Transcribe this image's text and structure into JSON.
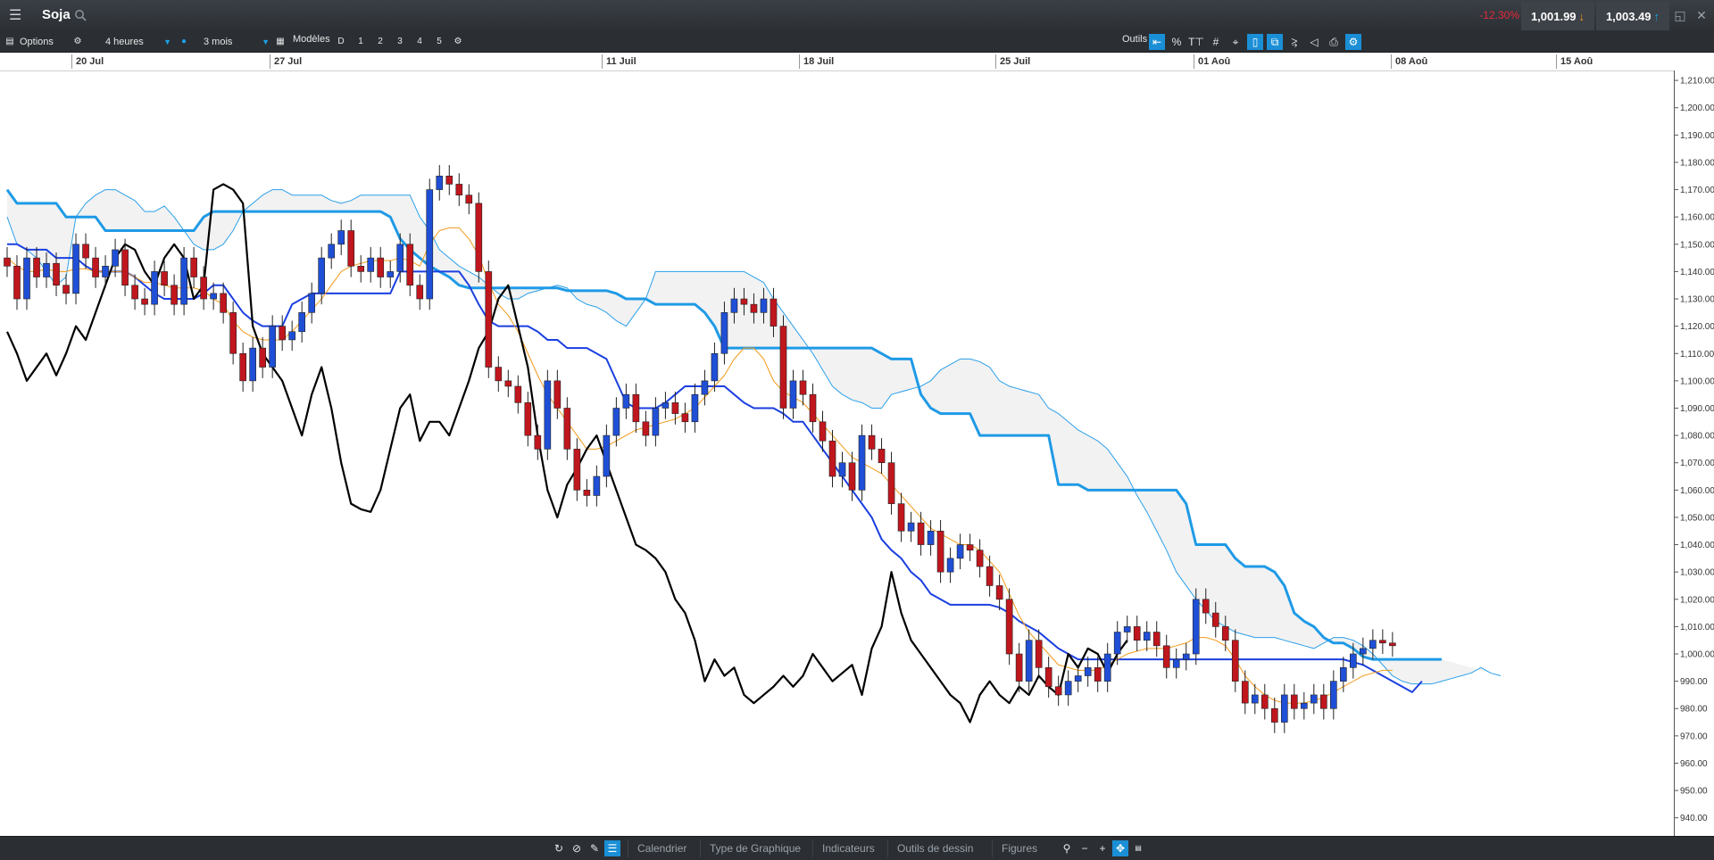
{
  "app": {
    "title": "Soja",
    "change_pct": "-12.30%",
    "sell_price": "1,001.99",
    "buy_price": "1,003.49",
    "colors": {
      "sell_arrow": "#f39a1b",
      "buy_arrow": "#1aa1e6",
      "negative": "#e6293a"
    }
  },
  "toolbar": {
    "options_label": "Options",
    "interval": "4 heures",
    "range": "3 mois",
    "models_label": "Modèles",
    "model_slots": [
      "D",
      "1",
      "2",
      "3",
      "4",
      "5"
    ],
    "tools_label": "Outils",
    "tool_icons": [
      "arrow-left-icon",
      "percent-icon",
      "text-icon",
      "grid-icon",
      "crosshair-icon",
      "candlestick-icon",
      "link-icon",
      "indicator-icon",
      "tag-icon",
      "print-icon",
      "settings-icon"
    ]
  },
  "timeline": {
    "dates": [
      "20 Jul",
      "27 Jul",
      "11 Juil",
      "18 Juil",
      "25 Juil",
      "01 Aoû",
      "08 Aoû",
      "15 Aoû"
    ]
  },
  "bottombar": {
    "tabs": [
      "Calendrier",
      "Type de Graphique",
      "Indicateurs",
      "Outils de dessin",
      "Figures"
    ]
  },
  "chart_data": {
    "type": "candlestick",
    "y_ticks": [
      "1,210.00",
      "1,200.00",
      "1,190.00",
      "1,180.00",
      "1,170.00",
      "1,160.00",
      "1,150.00",
      "1,140.00",
      "1,130.00",
      "1,120.00",
      "1,110.00",
      "1,100.00",
      "1,090.00",
      "1,080.00",
      "1,070.00",
      "1,060.00",
      "1,050.00",
      "1,040.00",
      "1,030.00",
      "1,020.00",
      "1,010.00",
      "1,000.00",
      "990.00",
      "980.00",
      "970.00",
      "960.00",
      "950.00",
      "940.00"
    ],
    "ylim": [
      935,
      1212
    ],
    "colors": {
      "up": "#1f4fd6",
      "down": "#c0161d",
      "tenkan": "#f39a1b",
      "kijun": "#1a3fe0",
      "chikou": "#000000",
      "senkou_a": "#2aa0ea",
      "senkou_b": "#1f9ae6",
      "cloud": "#f2f2f2"
    },
    "close": [
      1142,
      1130,
      1145,
      1138,
      1143,
      1135,
      1132,
      1150,
      1145,
      1138,
      1142,
      1148,
      1135,
      1130,
      1128,
      1140,
      1135,
      1128,
      1145,
      1138,
      1130,
      1132,
      1125,
      1110,
      1100,
      1112,
      1105,
      1120,
      1115,
      1118,
      1125,
      1132,
      1145,
      1150,
      1155,
      1142,
      1140,
      1145,
      1138,
      1140,
      1150,
      1135,
      1130,
      1170,
      1175,
      1172,
      1168,
      1165,
      1140,
      1105,
      1100,
      1098,
      1092,
      1080,
      1075,
      1100,
      1090,
      1075,
      1060,
      1058,
      1065,
      1080,
      1090,
      1095,
      1085,
      1080,
      1090,
      1092,
      1088,
      1085,
      1095,
      1100,
      1110,
      1125,
      1130,
      1128,
      1125,
      1130,
      1120,
      1090,
      1100,
      1095,
      1085,
      1078,
      1065,
      1070,
      1060,
      1080,
      1075,
      1070,
      1055,
      1045,
      1048,
      1040,
      1045,
      1030,
      1035,
      1040,
      1038,
      1032,
      1025,
      1020,
      1000,
      990,
      1005,
      995,
      988,
      985,
      990,
      992,
      995,
      990,
      1000,
      1008,
      1010,
      1005,
      1008,
      1003,
      995,
      998,
      1000,
      1020,
      1015,
      1010,
      1005,
      990,
      982,
      985,
      980,
      975,
      985,
      980,
      982,
      985,
      980,
      990,
      995,
      1000,
      1002,
      1005,
      1004,
      1003
    ],
    "tenkan": [
      1145,
      1142,
      1140,
      1140,
      1141,
      1140,
      1140,
      1141,
      1141,
      1140,
      1140,
      1140,
      1140,
      1138,
      1136,
      1136,
      1135,
      1134,
      1134,
      1134,
      1133,
      1130,
      1128,
      1122,
      1118,
      1116,
      1115,
      1115,
      1115,
      1118,
      1122,
      1126,
      1130,
      1135,
      1140,
      1142,
      1143,
      1144,
      1144,
      1144,
      1145,
      1144,
      1142,
      1150,
      1155,
      1156,
      1156,
      1152,
      1146,
      1136,
      1128,
      1124,
      1118,
      1110,
      1102,
      1095,
      1090,
      1085,
      1080,
      1075,
      1075,
      1076,
      1078,
      1080,
      1082,
      1083,
      1084,
      1085,
      1086,
      1088,
      1090,
      1094,
      1098,
      1102,
      1108,
      1112,
      1112,
      1108,
      1100,
      1096,
      1094,
      1092,
      1088,
      1084,
      1080,
      1076,
      1072,
      1070,
      1068,
      1066,
      1062,
      1058,
      1054,
      1050,
      1046,
      1044,
      1042,
      1040,
      1040,
      1038,
      1034,
      1030,
      1022,
      1014,
      1008,
      1004,
      1000,
      996,
      995,
      994,
      994,
      994,
      996,
      998,
      1000,
      1001,
      1002,
      1002,
      1002,
      1003,
      1004,
      1006,
      1006,
      1005,
      1003,
      998,
      992,
      988,
      985,
      983,
      982,
      982,
      982,
      983,
      984,
      986,
      988,
      990,
      992,
      993,
      994,
      994
    ],
    "kijun": [
      1150,
      1150,
      1148,
      1148,
      1148,
      1145,
      1145,
      1145,
      1142,
      1140,
      1140,
      1140,
      1140,
      1138,
      1135,
      1132,
      1130,
      1130,
      1130,
      1130,
      1132,
      1135,
      1135,
      1130,
      1125,
      1122,
      1120,
      1120,
      1120,
      1128,
      1130,
      1132,
      1132,
      1132,
      1132,
      1132,
      1132,
      1132,
      1132,
      1132,
      1140,
      1140,
      1140,
      1140,
      1140,
      1140,
      1140,
      1135,
      1128,
      1122,
      1120,
      1120,
      1120,
      1120,
      1118,
      1115,
      1115,
      1112,
      1112,
      1112,
      1110,
      1108,
      1100,
      1092,
      1090,
      1090,
      1090,
      1092,
      1095,
      1098,
      1098,
      1098,
      1098,
      1098,
      1095,
      1092,
      1090,
      1090,
      1090,
      1088,
      1085,
      1085,
      1080,
      1075,
      1070,
      1065,
      1060,
      1055,
      1050,
      1042,
      1038,
      1035,
      1030,
      1027,
      1022,
      1020,
      1018,
      1018,
      1018,
      1018,
      1018,
      1017,
      1015,
      1012,
      1010,
      1008,
      1005,
      1002,
      1000,
      998,
      998,
      998,
      998,
      998,
      998,
      998,
      998,
      998,
      998,
      998,
      998,
      998,
      998,
      998,
      998,
      998,
      998,
      998,
      998,
      998,
      998,
      998,
      998,
      998,
      998,
      998,
      998,
      997,
      996,
      994,
      992,
      990,
      988,
      986,
      990
    ],
    "senkou_a": [
      1160,
      1150,
      1148,
      1145,
      1140,
      1135,
      1138,
      1160,
      1165,
      1168,
      1170,
      1170,
      1168,
      1166,
      1162,
      1162,
      1164,
      1160,
      1155,
      1150,
      1148,
      1148,
      1150,
      1155,
      1162,
      1165,
      1168,
      1170,
      1170,
      1168,
      1168,
      1168,
      1168,
      1166,
      1165,
      1166,
      1168,
      1168,
      1168,
      1168,
      1168,
      1168,
      1160,
      1155,
      1148,
      1145,
      1142,
      1140,
      1138,
      1135,
      1132,
      1130,
      1130,
      1132,
      1133,
      1134,
      1135,
      1134,
      1130,
      1128,
      1127,
      1125,
      1122,
      1120,
      1125,
      1130,
      1140,
      1140,
      1140,
      1140,
      1140,
      1140,
      1140,
      1140,
      1140,
      1140,
      1138,
      1136,
      1130,
      1125,
      1120,
      1115,
      1110,
      1104,
      1098,
      1095,
      1093,
      1092,
      1090,
      1090,
      1095,
      1096,
      1097,
      1098,
      1100,
      1104,
      1106,
      1108,
      1108,
      1107,
      1105,
      1100,
      1098,
      1097,
      1096,
      1095,
      1090,
      1088,
      1085,
      1082,
      1080,
      1078,
      1075,
      1070,
      1065,
      1058,
      1052,
      1045,
      1038,
      1030,
      1025,
      1020,
      1016,
      1012,
      1010,
      1008,
      1007,
      1006,
      1006,
      1006,
      1005,
      1004,
      1003,
      1002,
      1004,
      1006,
      1006,
      1005,
      1003,
      1000,
      996,
      992,
      990,
      989,
      989,
      989,
      990,
      991,
      992,
      993,
      995,
      993,
      992
    ],
    "senkou_b": [
      1170,
      1165,
      1165,
      1165,
      1165,
      1165,
      1160,
      1160,
      1160,
      1160,
      1155,
      1155,
      1155,
      1155,
      1155,
      1155,
      1155,
      1155,
      1155,
      1155,
      1160,
      1162,
      1162,
      1162,
      1162,
      1162,
      1162,
      1162,
      1162,
      1162,
      1162,
      1162,
      1162,
      1162,
      1162,
      1162,
      1162,
      1162,
      1162,
      1160,
      1152,
      1148,
      1145,
      1142,
      1140,
      1138,
      1135,
      1134,
      1134,
      1134,
      1134,
      1134,
      1134,
      1134,
      1134,
      1134,
      1134,
      1133,
      1133,
      1133,
      1133,
      1133,
      1132,
      1130,
      1130,
      1130,
      1128,
      1128,
      1128,
      1128,
      1128,
      1125,
      1120,
      1112,
      1112,
      1112,
      1112,
      1112,
      1112,
      1112,
      1112,
      1112,
      1112,
      1112,
      1112,
      1112,
      1112,
      1112,
      1112,
      1110,
      1108,
      1108,
      1108,
      1095,
      1090,
      1088,
      1088,
      1088,
      1088,
      1080,
      1080,
      1080,
      1080,
      1080,
      1080,
      1080,
      1080,
      1062,
      1062,
      1062,
      1060,
      1060,
      1060,
      1060,
      1060,
      1060,
      1060,
      1060,
      1060,
      1060,
      1055,
      1040,
      1040,
      1040,
      1040,
      1035,
      1032,
      1032,
      1032,
      1030,
      1025,
      1015,
      1012,
      1010,
      1006,
      1004,
      1004,
      1002,
      999,
      998,
      998,
      998,
      998,
      998,
      998,
      998,
      998
    ],
    "chikou": [
      1118,
      1110,
      1100,
      1105,
      1110,
      1102,
      1110,
      1120,
      1115,
      1125,
      1135,
      1145,
      1150,
      1148,
      1140,
      1135,
      1145,
      1150,
      1145,
      1130,
      1135,
      1170,
      1172,
      1170,
      1165,
      1120,
      1110,
      1105,
      1100,
      1090,
      1080,
      1095,
      1105,
      1090,
      1070,
      1055,
      1053,
      1052,
      1060,
      1075,
      1090,
      1095,
      1078,
      1085,
      1085,
      1080,
      1090,
      1100,
      1112,
      1118,
      1130,
      1135,
      1120,
      1105,
      1080,
      1060,
      1050,
      1062,
      1068,
      1075,
      1080,
      1070,
      1060,
      1050,
      1040,
      1038,
      1035,
      1030,
      1020,
      1015,
      1005,
      990,
      998,
      992,
      995,
      985,
      982,
      985,
      988,
      992,
      988,
      992,
      1000,
      995,
      990,
      993,
      996,
      985,
      1002,
      1010,
      1030,
      1015,
      1005,
      1000,
      995,
      990,
      985,
      982,
      975,
      985,
      990,
      985,
      982,
      988,
      985,
      992,
      988,
      985,
      1000,
      995,
      1002,
      1000,
      993,
      1000,
      1005
    ],
    "chikou_offset": -26,
    "future_bars": 22
  }
}
